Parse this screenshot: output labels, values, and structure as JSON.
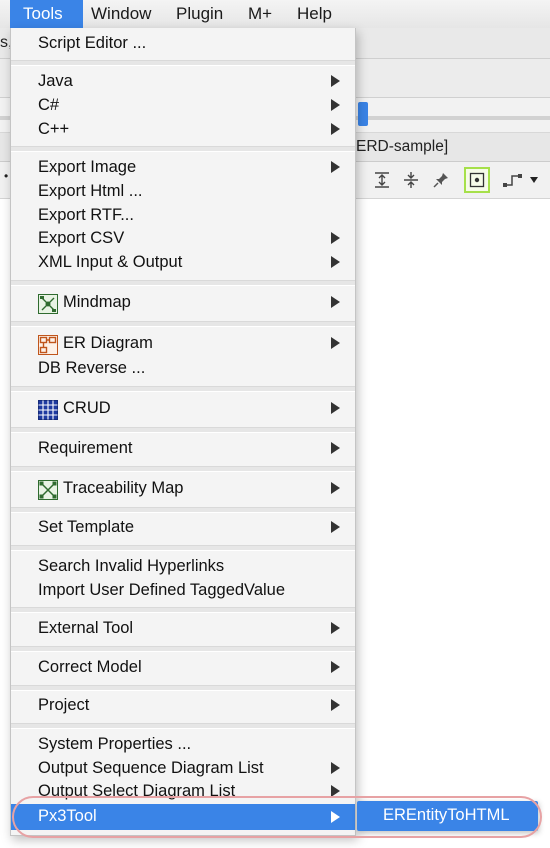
{
  "menubar": {
    "items": [
      "Tools",
      "Window",
      "Plugin",
      "M+",
      "Help"
    ]
  },
  "background": {
    "fragment_left": "s,",
    "fragment_title": "ERD-sample]"
  },
  "tools_menu": {
    "script_editor": "Script Editor ...",
    "java": "Java",
    "csharp": "C#",
    "cpp": "C++",
    "export_image": "Export Image",
    "export_html": "Export Html ...",
    "export_rtf": "Export RTF...",
    "export_csv": "Export CSV",
    "xml_io": "XML Input & Output",
    "mindmap": "Mindmap",
    "er_diagram": "ER Diagram",
    "db_reverse": "DB Reverse ...",
    "crud": "CRUD",
    "requirement": "Requirement",
    "traceability_map": "Traceability Map",
    "set_template": "Set Template",
    "search_invalid": "Search Invalid Hyperlinks",
    "import_tagged": "Import User Defined TaggedValue",
    "external_tool": "External Tool",
    "correct_model": "Correct Model",
    "project": "Project",
    "system_properties": "System Properties ...",
    "output_sequence": "Output Sequence Diagram List",
    "output_select": "Output Select Diagram List",
    "px3tool": "Px3Tool"
  },
  "submenu": {
    "item": "EREntityToHTML"
  },
  "colors": {
    "highlight": "#3a84e7",
    "annotation": "#e7a2a4",
    "selected_tool": "#a6e04a"
  }
}
